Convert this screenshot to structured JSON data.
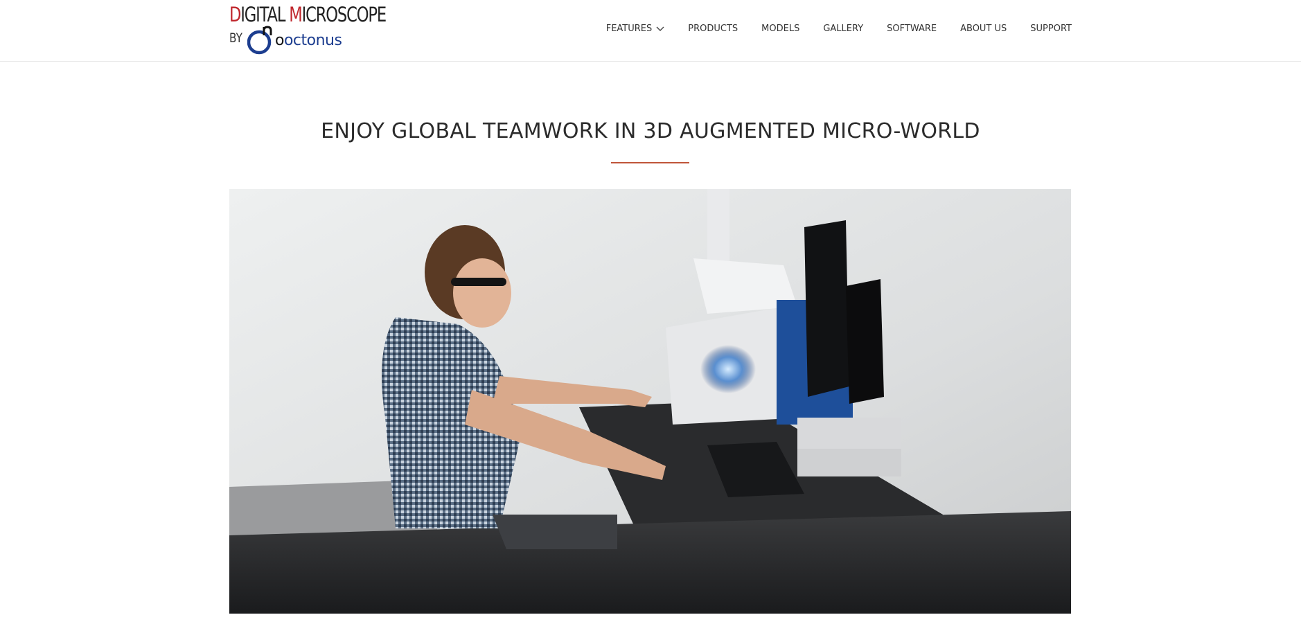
{
  "logo": {
    "line1_d": "D",
    "line1_rest1": "IGITAL ",
    "line1_m": "M",
    "line1_rest2": "ICROSCOPE",
    "by": "BY",
    "brand_dark": "o",
    "brand": "octonus"
  },
  "nav": {
    "items": [
      "FEATURES",
      "PRODUCTS",
      "MODELS",
      "GALLERY",
      "SOFTWARE",
      "ABOUT US",
      "SUPPORT"
    ]
  },
  "main": {
    "title": "ENJOY GLOBAL TEAMWORK IN 3D AUGMENTED MICRO-WORLD"
  },
  "colors": {
    "accent": "#c0272d",
    "brand_blue": "#1c3d8f",
    "underline": "#c0553a"
  },
  "icons": {
    "features_dropdown": "chevron-down-icon"
  }
}
